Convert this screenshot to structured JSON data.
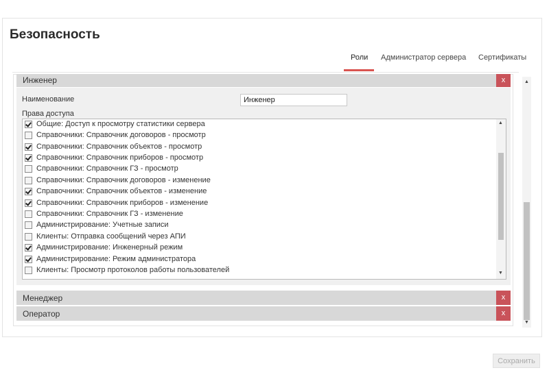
{
  "page": {
    "title": "Безопасность"
  },
  "tabs": [
    {
      "label": "Роли",
      "active": true
    },
    {
      "label": "Администратор сервера",
      "active": false
    },
    {
      "label": "Сертификаты",
      "active": false
    }
  ],
  "roles": [
    {
      "name": "Инженер",
      "delete_label": "x",
      "expanded": true
    },
    {
      "name": "Менеджер",
      "delete_label": "x",
      "expanded": false
    },
    {
      "name": "Оператор",
      "delete_label": "x",
      "expanded": false
    }
  ],
  "editor": {
    "name_label": "Наименование",
    "name_value": "Инженер",
    "rights_label": "Права доступа",
    "permissions": [
      {
        "label": "Общие: Доступ к просмотру статистики сервера",
        "checked": true
      },
      {
        "label": "Справочники: Справочник договоров - просмотр",
        "checked": false
      },
      {
        "label": "Справочники: Справочник объектов - просмотр",
        "checked": true
      },
      {
        "label": "Справочники: Справочник приборов - просмотр",
        "checked": true
      },
      {
        "label": "Справочники: Справочник ГЗ - просмотр",
        "checked": false
      },
      {
        "label": "Справочники: Справочник договоров - изменение",
        "checked": false
      },
      {
        "label": "Справочники: Справочник объектов - изменение",
        "checked": true
      },
      {
        "label": "Справочники: Справочник приборов - изменение",
        "checked": true
      },
      {
        "label": "Справочники: Справочник ГЗ - изменение",
        "checked": false
      },
      {
        "label": "Администрирование: Учетные записи",
        "checked": false
      },
      {
        "label": "Клиенты: Отправка сообщений через АПИ",
        "checked": false
      },
      {
        "label": "Администрирование: Инженерный режим",
        "checked": true
      },
      {
        "label": "Администрирование: Режим администратора",
        "checked": true
      },
      {
        "label": "Клиенты: Просмотр протоколов работы пользователей",
        "checked": false
      }
    ]
  },
  "scroll_arrows": {
    "up": "▲",
    "down": "▼"
  },
  "actions": {
    "save_label": "Сохранить"
  }
}
